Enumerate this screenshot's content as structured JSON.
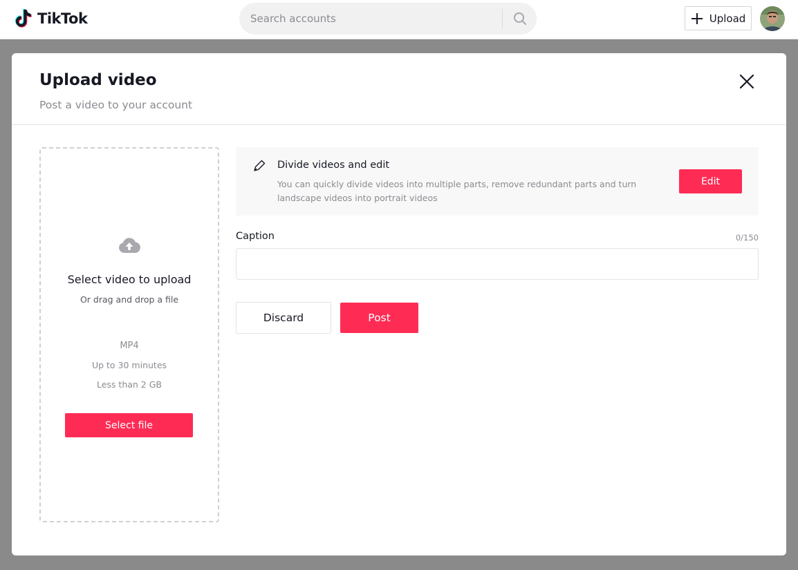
{
  "header": {
    "logo_text": "TikTok",
    "search": {
      "placeholder": "Search accounts",
      "value": ""
    },
    "upload_label": "Upload"
  },
  "modal": {
    "title": "Upload video",
    "subtitle": "Post a video to your account",
    "dropzone": {
      "title": "Select video to upload",
      "subtitle": "Or drag and drop a file",
      "format": "MP4",
      "duration": "Up to 30 minutes",
      "size": "Less than 2 GB",
      "button_label": "Select file"
    },
    "edit_card": {
      "title": "Divide videos and edit",
      "description": "You can quickly divide videos into multiple parts, remove redundant parts and turn landscape videos into portrait videos",
      "button_label": "Edit"
    },
    "caption": {
      "label": "Caption",
      "counter": "0/150",
      "value": ""
    },
    "discard_label": "Discard",
    "post_label": "Post"
  },
  "colors": {
    "accent": "#fe2c55",
    "text_primary": "#161823",
    "text_secondary": "#8a8b91",
    "overlay": "#8a8a8a"
  },
  "icons": {
    "logo": "tiktok-note-icon",
    "search": "search-icon",
    "upload": "plus-icon",
    "close": "close-icon",
    "cloud": "cloud-upload-icon",
    "pen": "pen-icon"
  }
}
